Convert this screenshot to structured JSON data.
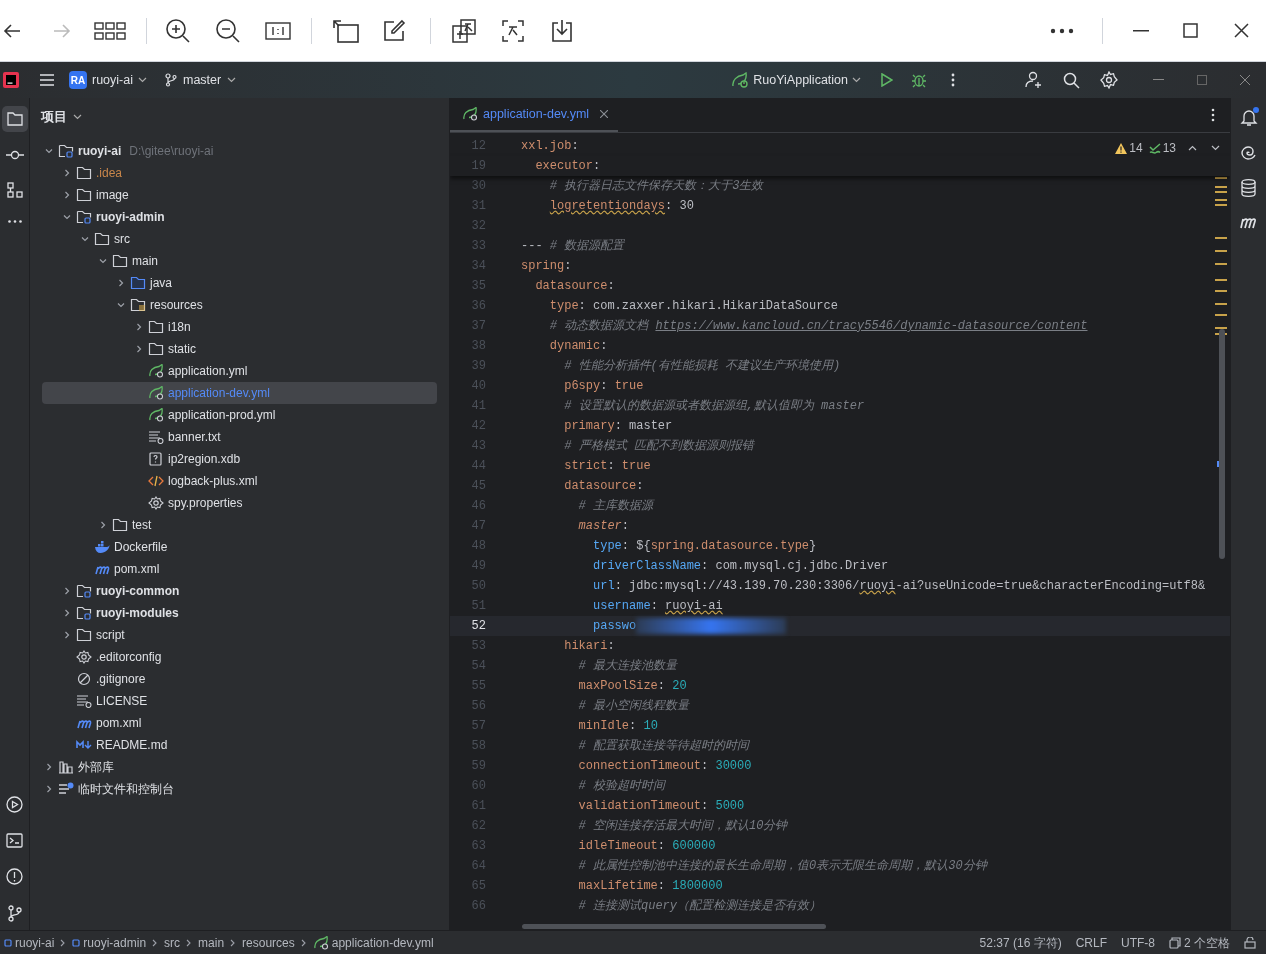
{
  "title_bar": {
    "project_badge": "RA",
    "project": "ruoyi-ai",
    "branch": "master",
    "run_config": "RuoYiApplication"
  },
  "project_panel": {
    "title": "项目",
    "tree": [
      {
        "name": "ruoyi-ai",
        "kind": "module",
        "bold": true,
        "path": "D:\\gitee\\ruoyi-ai",
        "expanded": true,
        "selected": false,
        "children": [
          {
            "name": ".idea",
            "kind": "folder",
            "ignored": true,
            "expanded": false,
            "selected": false
          },
          {
            "name": "image",
            "kind": "folder",
            "expanded": false,
            "selected": false
          },
          {
            "name": "ruoyi-admin",
            "kind": "module",
            "bold": true,
            "expanded": true,
            "selected": false,
            "children": [
              {
                "name": "src",
                "kind": "folder",
                "expanded": true,
                "selected": false,
                "children": [
                  {
                    "name": "main",
                    "kind": "folder",
                    "expanded": true,
                    "selected": false,
                    "children": [
                      {
                        "name": "java",
                        "kind": "source-folder",
                        "expanded": false,
                        "selected": false
                      },
                      {
                        "name": "resources",
                        "kind": "resources-folder",
                        "expanded": true,
                        "selected": false,
                        "children": [
                          {
                            "name": "i18n",
                            "kind": "folder",
                            "expanded": false,
                            "selected": false
                          },
                          {
                            "name": "static",
                            "kind": "folder",
                            "expanded": false,
                            "selected": false
                          },
                          {
                            "name": "application.yml",
                            "kind": "spring",
                            "selected": false
                          },
                          {
                            "name": "application-dev.yml",
                            "kind": "spring",
                            "selected": true
                          },
                          {
                            "name": "application-prod.yml",
                            "kind": "spring",
                            "selected": false
                          },
                          {
                            "name": "banner.txt",
                            "kind": "text",
                            "selected": false
                          },
                          {
                            "name": "ip2region.xdb",
                            "kind": "unknown",
                            "selected": false
                          },
                          {
                            "name": "logback-plus.xml",
                            "kind": "xml",
                            "selected": false
                          },
                          {
                            "name": "spy.properties",
                            "kind": "config",
                            "selected": false
                          }
                        ]
                      }
                    ]
                  },
                  {
                    "name": "test",
                    "kind": "folder",
                    "expanded": false,
                    "selected": false
                  }
                ]
              },
              {
                "name": "Dockerfile",
                "kind": "docker",
                "selected": false
              },
              {
                "name": "pom.xml",
                "kind": "maven",
                "selected": false
              }
            ]
          },
          {
            "name": "ruoyi-common",
            "kind": "module",
            "bold": true,
            "expanded": false,
            "selected": false
          },
          {
            "name": "ruoyi-modules",
            "kind": "module",
            "bold": true,
            "expanded": false,
            "selected": false
          },
          {
            "name": "script",
            "kind": "folder",
            "expanded": false,
            "selected": false
          },
          {
            "name": ".editorconfig",
            "kind": "config",
            "selected": false
          },
          {
            "name": ".gitignore",
            "kind": "ignore",
            "selected": false
          },
          {
            "name": "LICENSE",
            "kind": "text",
            "selected": false
          },
          {
            "name": "pom.xml",
            "kind": "maven",
            "selected": false
          },
          {
            "name": "README.md",
            "kind": "markdown",
            "selected": false
          }
        ]
      },
      {
        "name": "外部库",
        "kind": "library",
        "expanded": false,
        "selected": false
      },
      {
        "name": "临时文件和控制台",
        "kind": "scratch",
        "expanded": false,
        "selected": false
      }
    ]
  },
  "editor": {
    "tabs": [
      {
        "label": "application-dev.yml",
        "selected": true
      }
    ],
    "inspections": {
      "warnings": "14",
      "weak_warnings": "13"
    },
    "lines": [
      {
        "number": "12",
        "sticky": true,
        "tokens": [
          {
            "kind": "key",
            "text": "xxl.job"
          },
          {
            "kind": "plain",
            "text": ":"
          }
        ]
      },
      {
        "number": "19",
        "sticky": true,
        "tokens": [
          {
            "kind": "key",
            "text": "  executor"
          },
          {
            "kind": "plain",
            "text": ":"
          }
        ]
      },
      {
        "number": "30",
        "tokens": [
          {
            "kind": "comment",
            "text": "    # 执行器日志文件保存天数：大于3生效"
          }
        ]
      },
      {
        "number": "31",
        "tokens": [
          {
            "kind": "key",
            "text": "    logretentiondays",
            "squiggle": true
          },
          {
            "kind": "plain",
            "text": ": 30"
          }
        ]
      },
      {
        "number": "32"
      },
      {
        "number": "33",
        "tokens": [
          {
            "kind": "plain",
            "text": "--- "
          },
          {
            "kind": "comment",
            "text": "# 数据源配置"
          }
        ]
      },
      {
        "number": "34",
        "tokens": [
          {
            "kind": "key",
            "text": "spring"
          },
          {
            "kind": "plain",
            "text": ":"
          }
        ]
      },
      {
        "number": "35",
        "tokens": [
          {
            "kind": "key",
            "text": "  datasource"
          },
          {
            "kind": "plain",
            "text": ":"
          }
        ]
      },
      {
        "number": "36",
        "tokens": [
          {
            "kind": "key",
            "text": "    type"
          },
          {
            "kind": "plain",
            "text": ": com.zaxxer.hikari.HikariDataSource"
          }
        ]
      },
      {
        "number": "37",
        "tokens": [
          {
            "kind": "comment",
            "text": "    # 动态数据源文档 "
          },
          {
            "kind": "link",
            "text": "https://www.kancloud.cn/tracy5546/dynamic-datasource/content"
          }
        ]
      },
      {
        "number": "38",
        "tokens": [
          {
            "kind": "key",
            "text": "    dynamic"
          },
          {
            "kind": "plain",
            "text": ":"
          }
        ]
      },
      {
        "number": "39",
        "tokens": [
          {
            "kind": "comment",
            "text": "      # 性能分析插件(有性能损耗 不建议生产环境使用)"
          }
        ]
      },
      {
        "number": "40",
        "tokens": [
          {
            "kind": "key",
            "text": "      p6spy"
          },
          {
            "kind": "plain",
            "text": ": "
          },
          {
            "kind": "bool",
            "text": "true"
          }
        ]
      },
      {
        "number": "41",
        "tokens": [
          {
            "kind": "comment",
            "text": "      # 设置默认的数据源或者数据源组,默认值即为 master"
          }
        ]
      },
      {
        "number": "42",
        "tokens": [
          {
            "kind": "key",
            "text": "      primary"
          },
          {
            "kind": "plain",
            "text": ": master"
          }
        ]
      },
      {
        "number": "43",
        "tokens": [
          {
            "kind": "comment",
            "text": "      # 严格模式 匹配不到数据源则报错"
          }
        ]
      },
      {
        "number": "44",
        "tokens": [
          {
            "kind": "key",
            "text": "      strict"
          },
          {
            "kind": "plain",
            "text": ": "
          },
          {
            "kind": "bool",
            "text": "true"
          }
        ]
      },
      {
        "number": "45",
        "tokens": [
          {
            "kind": "key",
            "text": "      datasource"
          },
          {
            "kind": "plain",
            "text": ":"
          }
        ]
      },
      {
        "number": "46",
        "tokens": [
          {
            "kind": "comment",
            "text": "        # 主库数据源"
          }
        ]
      },
      {
        "number": "47",
        "tokens": [
          {
            "kind": "italic-key",
            "text": "        master"
          },
          {
            "kind": "plain",
            "text": ":"
          }
        ]
      },
      {
        "number": "48",
        "tokens": [
          {
            "kind": "prop",
            "text": "          type"
          },
          {
            "kind": "plain",
            "text": ": ${"
          },
          {
            "kind": "ref",
            "text": "spring.datasource.type"
          },
          {
            "kind": "plain",
            "text": "}"
          }
        ]
      },
      {
        "number": "49",
        "tokens": [
          {
            "kind": "prop",
            "text": "          driverClassName"
          },
          {
            "kind": "plain",
            "text": ": com.mysql.cj.jdbc.Driver"
          }
        ]
      },
      {
        "number": "50",
        "tokens": [
          {
            "kind": "prop",
            "text": "          url"
          },
          {
            "kind": "plain",
            "text": ": jdbc:mysql://43.139.70.230:3306/"
          },
          {
            "kind": "plain",
            "text": "ruoyi",
            "squiggle": true
          },
          {
            "kind": "plain",
            "text": "-ai?useUnicode=true&characterEncoding=utf8&"
          }
        ]
      },
      {
        "number": "51",
        "tokens": [
          {
            "kind": "prop",
            "text": "          username"
          },
          {
            "kind": "plain",
            "text": ": "
          },
          {
            "kind": "plain",
            "text": "ruoyi-ai",
            "squiggle": true
          }
        ]
      },
      {
        "number": "52",
        "current": true,
        "redacted": true,
        "tokens": [
          {
            "kind": "prop",
            "text": "          passwo"
          }
        ]
      },
      {
        "number": "53",
        "tokens": [
          {
            "kind": "key",
            "text": "      hikari"
          },
          {
            "kind": "plain",
            "text": ":"
          }
        ]
      },
      {
        "number": "54",
        "tokens": [
          {
            "kind": "comment",
            "text": "        # 最大连接池数量"
          }
        ]
      },
      {
        "number": "55",
        "tokens": [
          {
            "kind": "key",
            "text": "        maxPoolSize"
          },
          {
            "kind": "plain",
            "text": ": "
          },
          {
            "kind": "num",
            "text": "20"
          }
        ]
      },
      {
        "number": "56",
        "tokens": [
          {
            "kind": "comment",
            "text": "        # 最小空闲线程数量"
          }
        ]
      },
      {
        "number": "57",
        "tokens": [
          {
            "kind": "key",
            "text": "        minIdle"
          },
          {
            "kind": "plain",
            "text": ": "
          },
          {
            "kind": "num",
            "text": "10"
          }
        ]
      },
      {
        "number": "58",
        "tokens": [
          {
            "kind": "comment",
            "text": "        # 配置获取连接等待超时的时间"
          }
        ]
      },
      {
        "number": "59",
        "tokens": [
          {
            "kind": "key",
            "text": "        connectionTimeout"
          },
          {
            "kind": "plain",
            "text": ": "
          },
          {
            "kind": "num",
            "text": "30000"
          }
        ]
      },
      {
        "number": "60",
        "tokens": [
          {
            "kind": "comment",
            "text": "        # 校验超时时间"
          }
        ]
      },
      {
        "number": "61",
        "tokens": [
          {
            "kind": "key",
            "text": "        validationTimeout"
          },
          {
            "kind": "plain",
            "text": ": "
          },
          {
            "kind": "num",
            "text": "5000"
          }
        ]
      },
      {
        "number": "62",
        "tokens": [
          {
            "kind": "comment",
            "text": "        # 空闲连接存活最大时间，默认10分钟"
          }
        ]
      },
      {
        "number": "63",
        "tokens": [
          {
            "kind": "key",
            "text": "        idleTimeout"
          },
          {
            "kind": "plain",
            "text": ": "
          },
          {
            "kind": "num",
            "text": "600000"
          }
        ]
      },
      {
        "number": "64",
        "tokens": [
          {
            "kind": "comment",
            "text": "        # 此属性控制池中连接的最长生命周期，值0表示无限生命周期，默认30分钟"
          }
        ]
      },
      {
        "number": "65",
        "tokens": [
          {
            "kind": "key",
            "text": "        maxLifetime"
          },
          {
            "kind": "plain",
            "text": ": "
          },
          {
            "kind": "num",
            "text": "1800000"
          }
        ]
      },
      {
        "number": "66",
        "tokens": [
          {
            "kind": "comment",
            "text": "        # 连接测试query（配置检测连接是否有效）"
          }
        ]
      }
    ]
  },
  "status_bar": {
    "breadcrumbs": [
      {
        "label": "ruoyi-ai",
        "kind": "module"
      },
      {
        "label": "ruoyi-admin",
        "kind": "module"
      },
      {
        "label": "src",
        "kind": "plain"
      },
      {
        "label": "main",
        "kind": "plain"
      },
      {
        "label": "resources",
        "kind": "plain"
      },
      {
        "label": "application-dev.yml",
        "kind": "spring"
      }
    ],
    "position": "52:37 (16 字符)",
    "line_separator": "CRLF",
    "encoding": "UTF-8",
    "indent": "2 个空格"
  }
}
